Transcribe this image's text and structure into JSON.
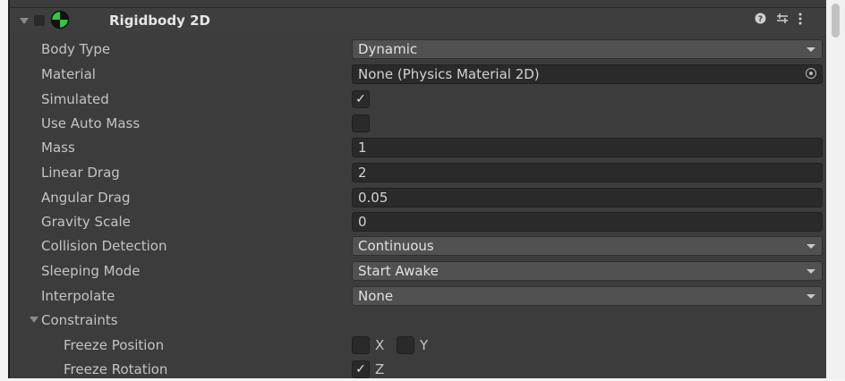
{
  "component": {
    "title": "Rigidbody 2D",
    "icons": [
      "help-icon",
      "preset-icon",
      "more-options-icon"
    ]
  },
  "fields": {
    "body_type": {
      "label": "Body Type",
      "value": "Dynamic"
    },
    "material": {
      "label": "Material",
      "value": "None (Physics Material 2D)"
    },
    "simulated": {
      "label": "Simulated",
      "checked": true,
      "mark": "✓"
    },
    "use_auto_mass": {
      "label": "Use Auto Mass",
      "checked": false
    },
    "mass": {
      "label": "Mass",
      "value": "1"
    },
    "linear_drag": {
      "label": "Linear Drag",
      "value": "2"
    },
    "angular_drag": {
      "label": "Angular Drag",
      "value": "0.05"
    },
    "gravity_scale": {
      "label": "Gravity Scale",
      "value": "0"
    },
    "collision_detection": {
      "label": "Collision Detection",
      "value": "Continuous"
    },
    "sleeping_mode": {
      "label": "Sleeping Mode",
      "value": "Start Awake"
    },
    "interpolate": {
      "label": "Interpolate",
      "value": "None"
    }
  },
  "constraints": {
    "label": "Constraints",
    "freeze_position": {
      "label": "Freeze Position",
      "x_label": "X",
      "y_label": "Y",
      "x": false,
      "y": false
    },
    "freeze_rotation": {
      "label": "Freeze Rotation",
      "z_label": "Z",
      "z": true,
      "mark": "✓"
    }
  },
  "colors": {
    "panel_bg": "#3c3c3c",
    "field_bg": "#2a2a2a",
    "dropdown_bg": "#515151",
    "text": "#c4c4c4",
    "icon_green": "#2fc93a"
  }
}
